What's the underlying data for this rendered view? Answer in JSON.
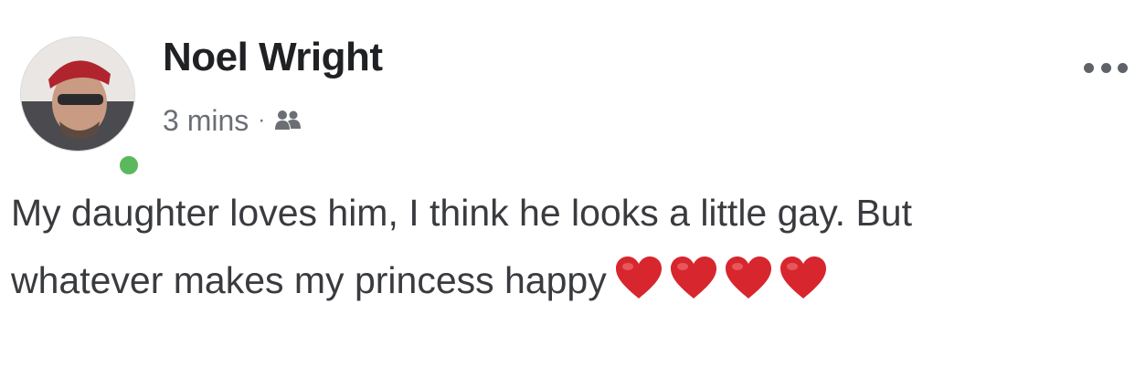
{
  "post": {
    "author": "Noel Wright",
    "time": "3 mins",
    "separator": "·",
    "audience_icon": "friends-icon",
    "online": true,
    "text_line_1": "My daughter loves him, I think he looks a little gay. But",
    "text_line_2": "whatever makes my princess happy",
    "emoji": [
      "red-heart",
      "red-heart",
      "red-heart",
      "red-heart"
    ]
  },
  "colors": {
    "online": "#5cb85c",
    "heart": "#d7262e",
    "author": "#202124",
    "meta": "#6b6f75",
    "body_text": "#3a3b3f"
  }
}
